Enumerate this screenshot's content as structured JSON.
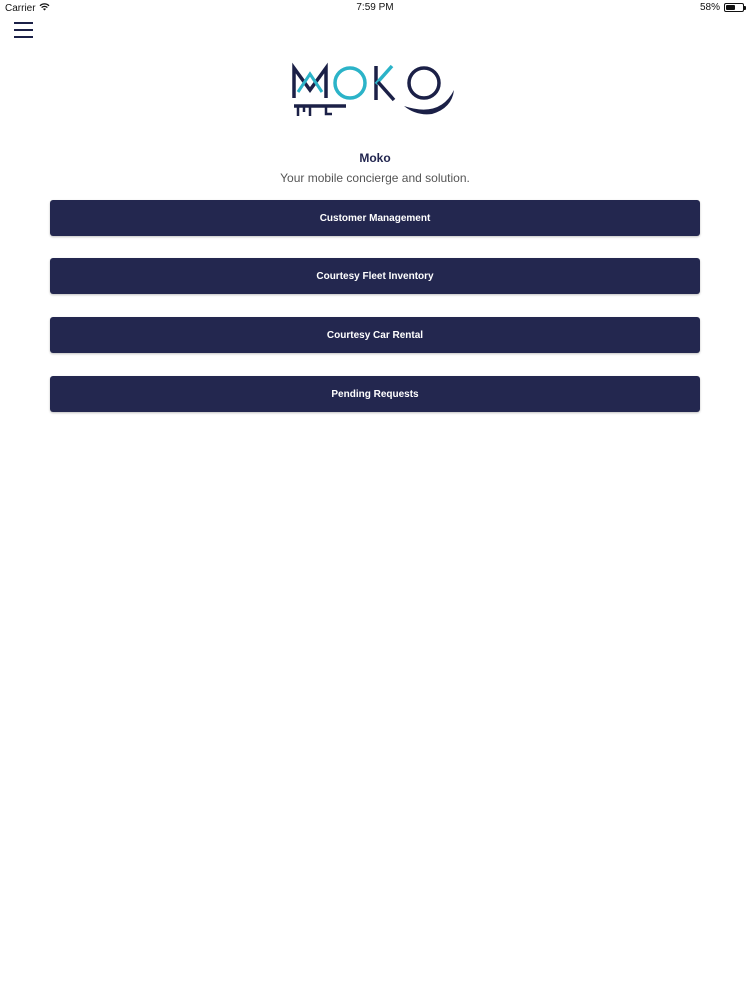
{
  "status_bar": {
    "carrier": "Carrier",
    "wifi_icon": "wifi-icon",
    "time": "7:59 PM",
    "battery": "58%",
    "battery_level": 0.58
  },
  "header": {
    "menu_icon": "hamburger-menu-icon"
  },
  "logo": {
    "alt": "MOKO",
    "colors": {
      "navy": "#1b2047",
      "teal": "#2bb3c8"
    }
  },
  "app": {
    "title": "Moko",
    "subtitle": "Your mobile concierge and solution."
  },
  "menu": {
    "items": [
      {
        "label": "Customer Management"
      },
      {
        "label": "Courtesy Fleet Inventory"
      },
      {
        "label": "Courtesy Car Rental"
      },
      {
        "label": "Pending Requests"
      }
    ],
    "button_color": "#23274f",
    "text_color": "#ffffff"
  }
}
